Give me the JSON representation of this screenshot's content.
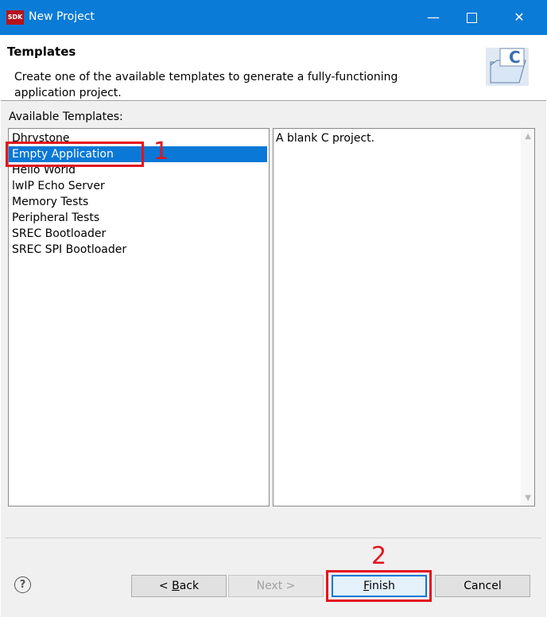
{
  "window": {
    "title": "New Project",
    "logo": "SDK",
    "minimize_glyph": "—",
    "close_glyph": "✕"
  },
  "header": {
    "title": "Templates",
    "description": "Create one of the available templates to generate a fully-functioning application project.",
    "icon": "c-folder-icon"
  },
  "templates": {
    "label": "Available Templates:",
    "items": [
      "Dhrystone",
      "Empty Application",
      "Hello World",
      "lwIP Echo Server",
      "Memory Tests",
      "Peripheral Tests",
      "SREC Bootloader",
      "SREC SPI Bootloader"
    ],
    "selected": "Empty Application"
  },
  "description_panel": {
    "text": "A blank C project."
  },
  "buttons": {
    "help": "?",
    "back_prefix": "< ",
    "back_mnemonic": "B",
    "back_rest": "ack",
    "next": "Next >",
    "finish_mnemonic": "F",
    "finish_rest": "inish",
    "cancel": "Cancel"
  },
  "annotations": {
    "step1": "1",
    "step2": "2",
    "color": "#e3141e"
  }
}
